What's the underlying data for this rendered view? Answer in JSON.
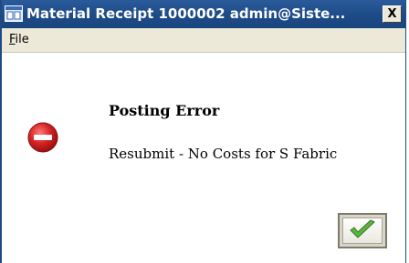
{
  "window": {
    "title": "Material Receipt  1000002  admin@Siste...",
    "close_symbol": "X"
  },
  "menu": {
    "file_mnemonic": "F",
    "file_rest": "ile"
  },
  "dialog": {
    "title": "Posting Error",
    "message": "Resubmit - No Costs for S Fabric",
    "icon": "error-stop-icon",
    "ok_icon": "checkmark-icon"
  },
  "colors": {
    "titlebar": "#1d4b87",
    "error_red": "#cc1f1f",
    "check_green": "#4fa83a"
  }
}
